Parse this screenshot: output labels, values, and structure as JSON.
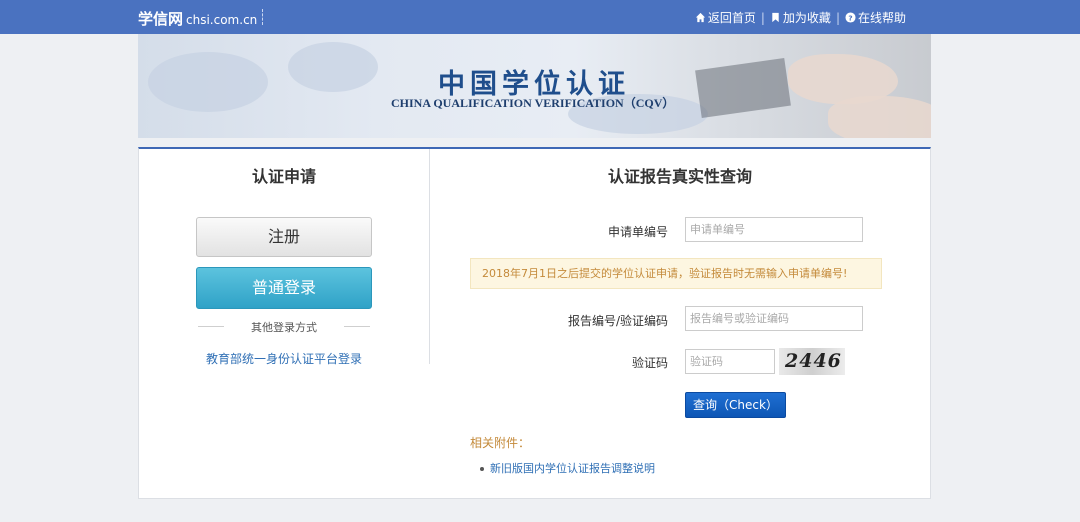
{
  "header": {
    "brand_name": "学信网",
    "brand_domain": "chsi.com.cn",
    "links": [
      {
        "icon": "home-icon",
        "label": "返回首页"
      },
      {
        "icon": "bookmark-icon",
        "label": "加为收藏"
      },
      {
        "icon": "help-icon",
        "label": "在线帮助"
      }
    ],
    "separator": "|"
  },
  "banner": {
    "title_cn": "中国学位认证",
    "title_en": "CHINA QUALIFICATION VERIFICATION（CQV）"
  },
  "left_panel": {
    "title": "认证申请",
    "register_label": "注册",
    "login_label": "普通登录",
    "other_login_label": "其他登录方式",
    "moe_login_link": "教育部统一身份认证平台登录"
  },
  "right_panel": {
    "title": "认证报告真实性查询",
    "application_no": {
      "label": "申请单编号",
      "placeholder": "申请单编号",
      "value": ""
    },
    "notice": "2018年7月1日之后提交的学位认证申请，验证报告时无需输入申请单编号!",
    "report_no": {
      "label": "报告编号/验证编码",
      "placeholder": "报告编号或验证编码",
      "value": ""
    },
    "captcha": {
      "label": "验证码",
      "placeholder": "验证码",
      "value": "",
      "image_text": "2446"
    },
    "query_button": "查询（Check）",
    "attachments_title": "相关附件：",
    "attachments": [
      "新旧版国内学位认证报告调整说明"
    ]
  },
  "colors": {
    "topbar": "#4a72c0",
    "login_button": "#3aaed0",
    "query_button": "#1565c8",
    "notice_text": "#c48a3a",
    "link": "#2f6fb5"
  }
}
